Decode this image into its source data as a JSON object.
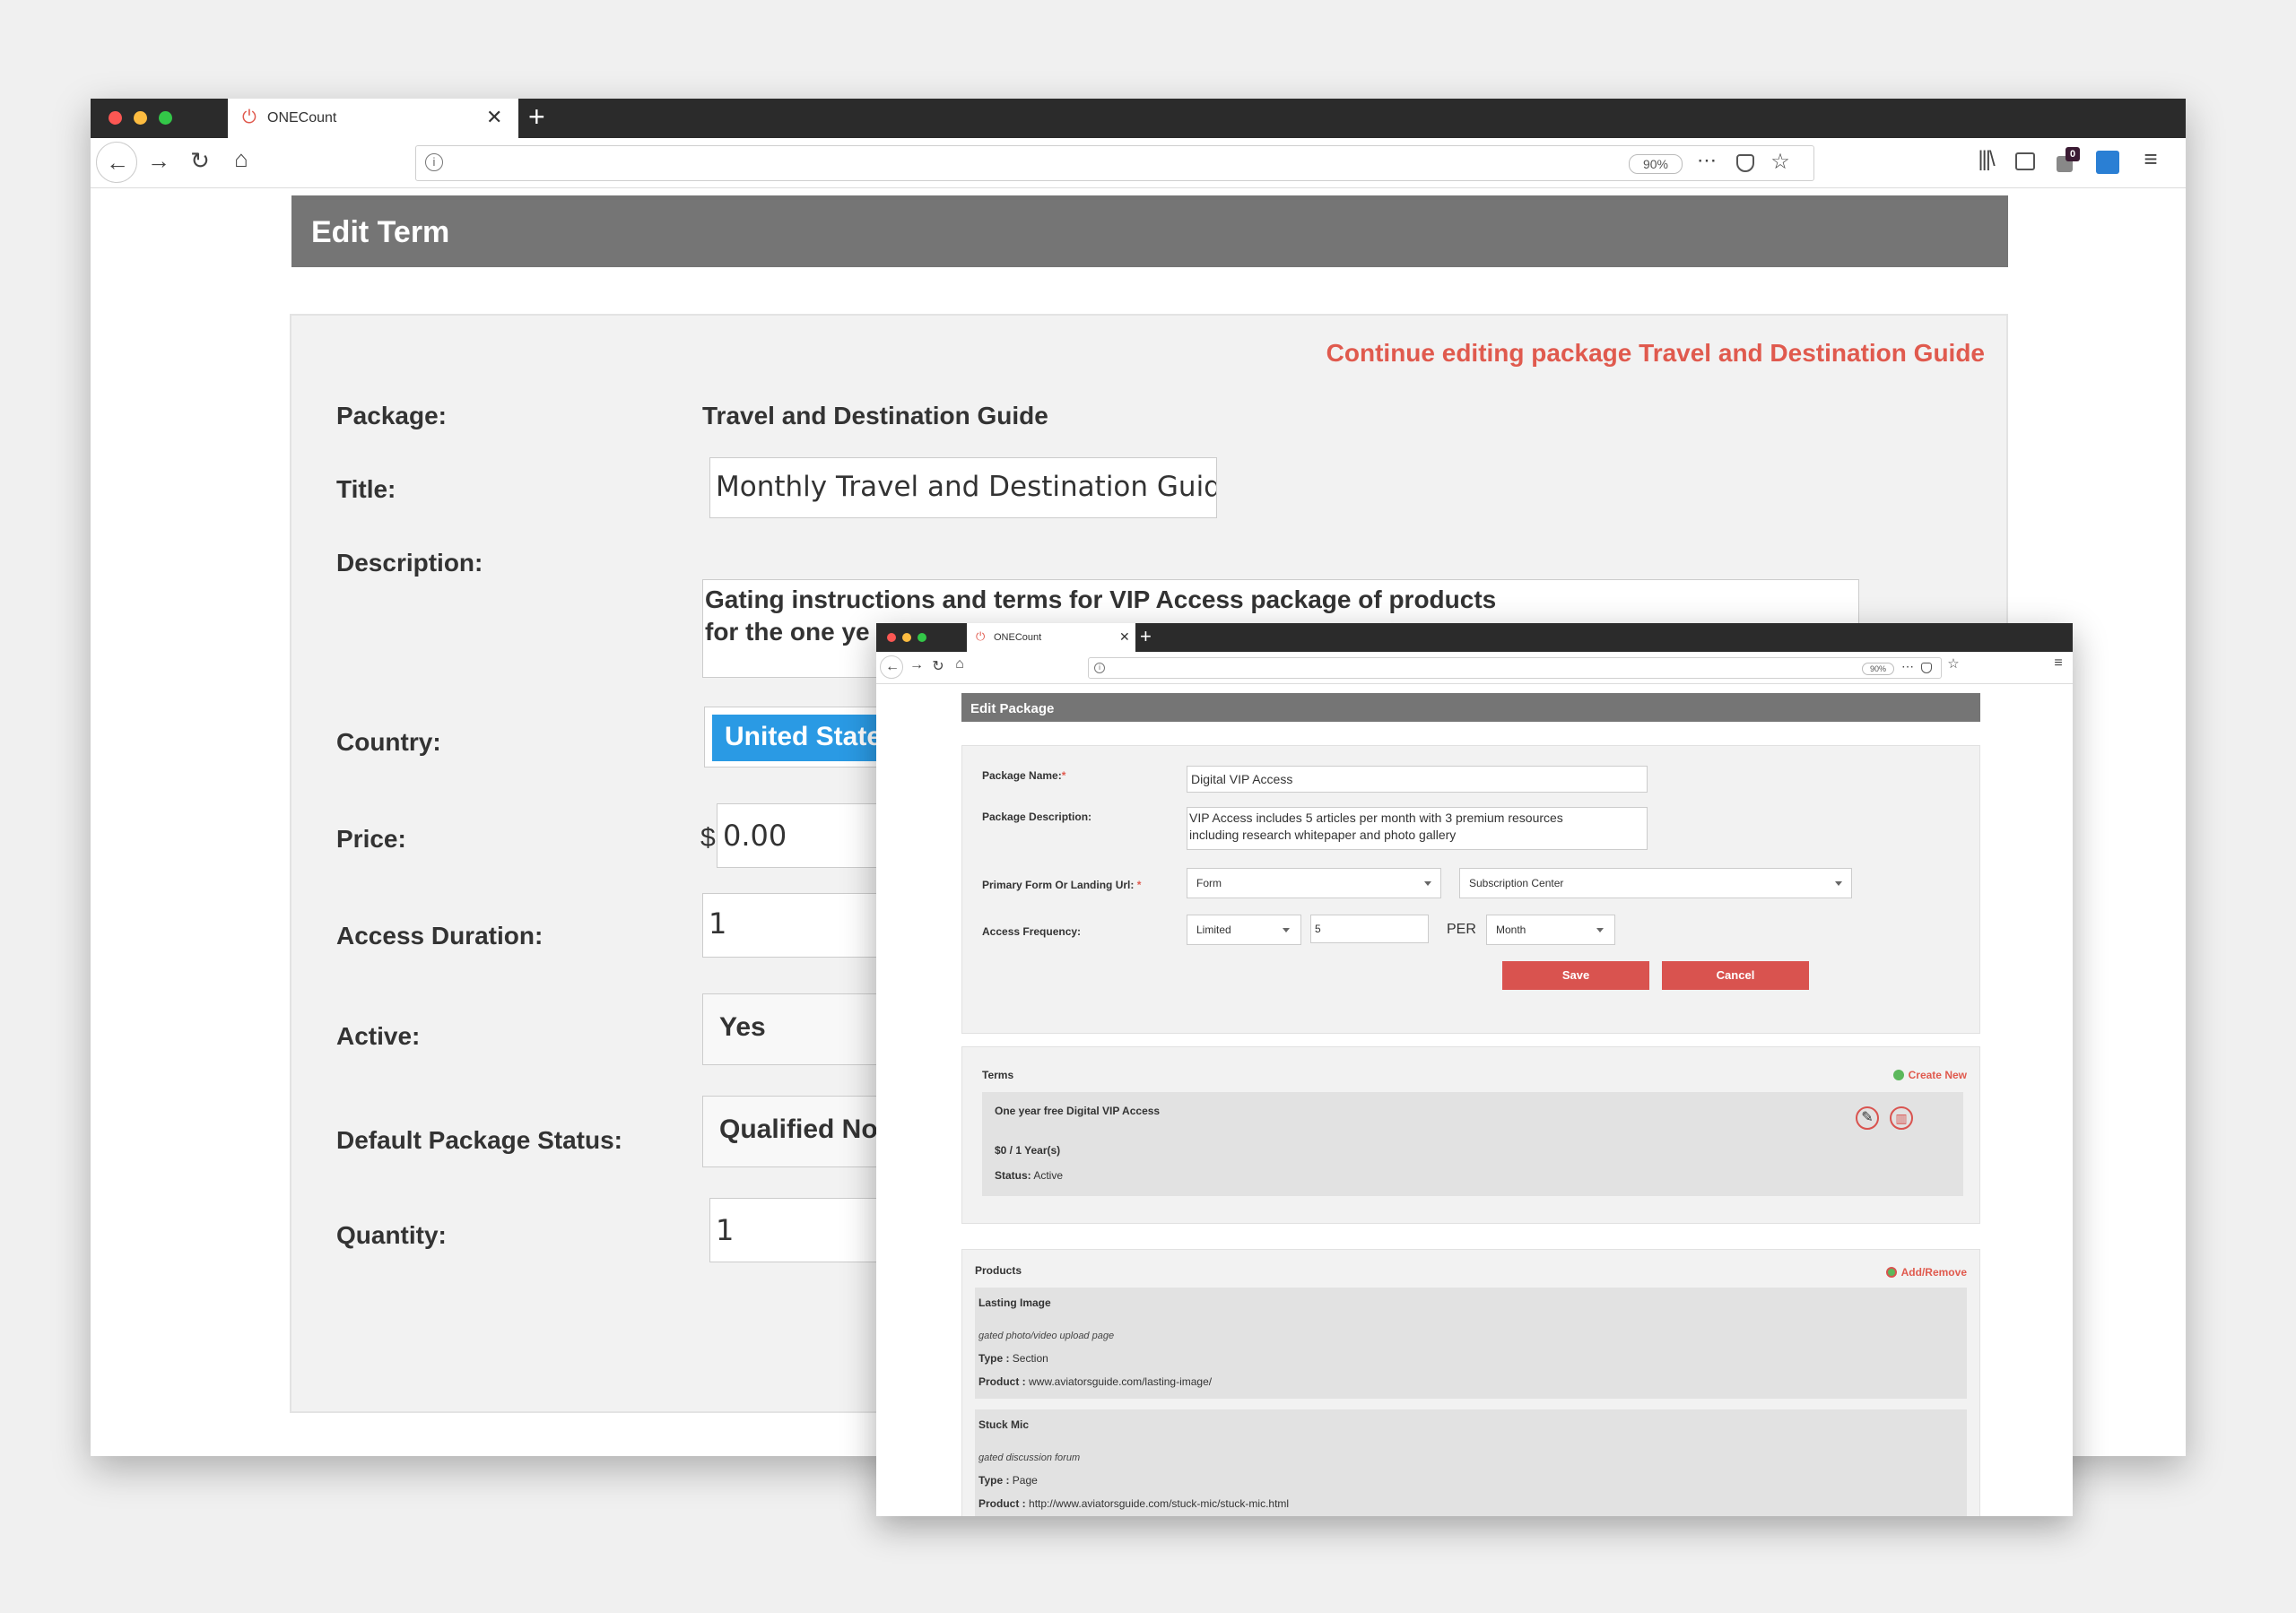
{
  "browser_back": {
    "tab_title": "ONECount",
    "new_tab_symbol": "+",
    "zoom": "90%",
    "notification_count": "0"
  },
  "edit_term": {
    "header": "Edit Term",
    "continue_link": "Continue editing package Travel and Destination Guide",
    "labels": {
      "package": "Package:",
      "title": "Title:",
      "description": "Description:",
      "country": "Country:",
      "price": "Price:",
      "access_duration": "Access Duration:",
      "active": "Active:",
      "default_status": "Default Package Status:",
      "quantity": "Quantity:"
    },
    "values": {
      "package": "Travel and Destination Guide",
      "title": "Monthly Travel and Destination Guid",
      "description_line1": "Gating instructions and terms for VIP Access package of products",
      "description_line2": "for the one ye",
      "country": "United State",
      "currency": "$",
      "price": "0.00",
      "access_duration": "1",
      "active": "Yes",
      "default_status": "Qualified No",
      "quantity": "1"
    }
  },
  "browser_front": {
    "tab_title": "ONECount",
    "new_tab_symbol": "+",
    "zoom": "90%"
  },
  "edit_package": {
    "header": "Edit Package",
    "labels": {
      "package_name": "Package Name:",
      "package_description": "Package Description:",
      "primary_form": "Primary Form Or Landing Url:",
      "access_frequency": "Access Frequency:",
      "required_mark": "*",
      "per": "PER"
    },
    "values": {
      "package_name": "Digital VIP Access",
      "description_line1": "VIP Access includes 5 articles per month with 3 premium resources",
      "description_line2": "including research whitepaper and photo gallery",
      "form_type": "Form",
      "form_name": "Subscription Center",
      "frequency_type": "Limited",
      "frequency_count": "5",
      "frequency_period": "Month"
    },
    "buttons": {
      "save": "Save",
      "cancel": "Cancel"
    },
    "terms": {
      "heading": "Terms",
      "create_new": "Create New",
      "item": {
        "title": "One year free Digital VIP Access",
        "price": "$0 / 1 Year(s)",
        "status_label": "Status:",
        "status_value": "Active"
      }
    },
    "products": {
      "heading": "Products",
      "add_remove": "Add/Remove",
      "type_label": "Type :",
      "product_label": "Product :",
      "items": [
        {
          "name": "Lasting Image",
          "description": "gated photo/video upload page",
          "type": "Section",
          "url": "www.aviatorsguide.com/lasting-image/"
        },
        {
          "name": "Stuck Mic",
          "description": "gated discussion forum",
          "type": "Page",
          "url": "http://www.aviatorsguide.com/stuck-mic/stuck-mic.html"
        }
      ]
    }
  }
}
